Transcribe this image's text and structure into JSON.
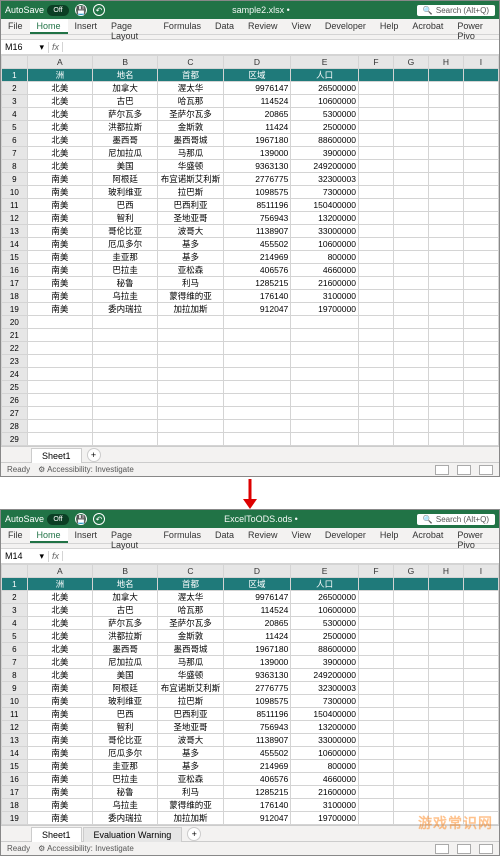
{
  "top": {
    "autosave": "AutoSave",
    "toggle": "Off",
    "filetitle": "sample2.xlsx  •",
    "searchLabel": "Search (Alt+Q)",
    "tabs": [
      "File",
      "Home",
      "Insert",
      "Page Layout",
      "Formulas",
      "Data",
      "Review",
      "View",
      "Developer",
      "Help",
      "Acrobat",
      "Power Pivo"
    ],
    "nameBox": "M16",
    "sheetTab": "Sheet1",
    "ready": "Ready",
    "access": "Accessibility: Investigate"
  },
  "bottom": {
    "autosave": "AutoSave",
    "toggle": "Off",
    "filetitle": "ExcelToODS.ods  •",
    "searchLabel": "Search (Alt+Q)",
    "tabs": [
      "File",
      "Home",
      "Insert",
      "Page Layout",
      "Formulas",
      "Data",
      "Review",
      "View",
      "Developer",
      "Help",
      "Acrobat",
      "Power Pivo"
    ],
    "nameBox": "M14",
    "sheetTabs": [
      "Sheet1",
      "Evaluation Warning"
    ],
    "ready": "Ready",
    "access": "Accessibility: Investigate"
  },
  "cols": [
    "",
    "A",
    "B",
    "C",
    "D",
    "E",
    "F",
    "G",
    "H",
    "I"
  ],
  "headerRow": [
    "洲",
    "地名",
    "首都",
    "区域",
    "人口"
  ],
  "rows": [
    [
      "北美",
      "加拿大",
      "渥太华",
      "9976147",
      "26500000"
    ],
    [
      "北美",
      "古巴",
      "哈瓦那",
      "114524",
      "10600000"
    ],
    [
      "北美",
      "萨尔瓦多",
      "圣萨尔瓦多",
      "20865",
      "5300000"
    ],
    [
      "北美",
      "洪都拉斯",
      "金斯敦",
      "11424",
      "2500000"
    ],
    [
      "北美",
      "墨西哥",
      "墨西哥城",
      "1967180",
      "88600000"
    ],
    [
      "北美",
      "尼加拉瓜",
      "马那瓜",
      "139000",
      "3900000"
    ],
    [
      "北美",
      "美国",
      "华盛顿",
      "9363130",
      "249200000"
    ],
    [
      "南美",
      "阿根廷",
      "布宜诺斯艾利斯",
      "2776775",
      "32300003"
    ],
    [
      "南美",
      "玻利维亚",
      "拉巴斯",
      "1098575",
      "7300000"
    ],
    [
      "南美",
      "巴西",
      "巴西利亚",
      "8511196",
      "150400000"
    ],
    [
      "南美",
      "智利",
      "圣地亚哥",
      "756943",
      "13200000"
    ],
    [
      "南美",
      "哥伦比亚",
      "波哥大",
      "1138907",
      "33000000"
    ],
    [
      "南美",
      "厄瓜多尔",
      "基多",
      "455502",
      "10600000"
    ],
    [
      "南美",
      "圭亚那",
      "基多",
      "214969",
      "800000"
    ],
    [
      "南美",
      "巴拉圭",
      "亚松森",
      "406576",
      "4660000"
    ],
    [
      "南美",
      "秘鲁",
      "利马",
      "1285215",
      "21600000"
    ],
    [
      "南美",
      "乌拉圭",
      "蒙得维的亚",
      "176140",
      "3100000"
    ],
    [
      "南美",
      "委内瑞拉",
      "加拉加斯",
      "912047",
      "19700000"
    ]
  ],
  "emptyTop": [
    20,
    21,
    22,
    23,
    24,
    25,
    26,
    27,
    28,
    29
  ],
  "watermark": "游戏常识网"
}
